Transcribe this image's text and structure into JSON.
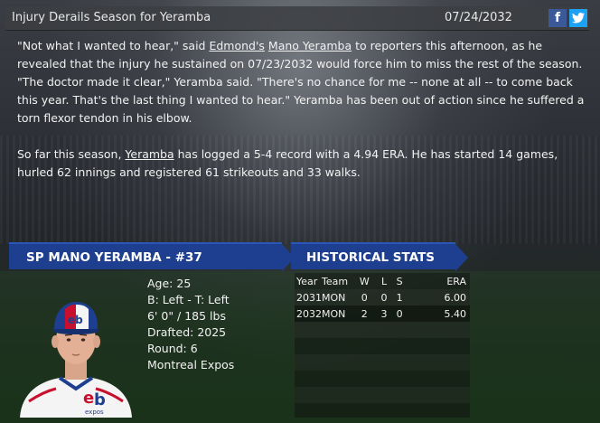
{
  "header": {
    "title": "Injury Derails Season for Yeramba",
    "date": "07/24/2032",
    "facebook_glyph": "f",
    "twitter_glyph": "t"
  },
  "article": {
    "p1_a": "\"Not what I wanted to hear,\" said ",
    "p1_team": "Edmond's",
    "p1_b": " ",
    "p1_player": "Mano Yeramba",
    "p1_c": " to reporters this afternoon, as he revealed that the injury he sustained on 07/23/2032 would force him to miss the rest of the season. \"The doctor made it clear,\" Yeramba said. \"There's no chance for me -- none at all -- to come back this year. That's the last thing I wanted to hear.\" Yeramba has been out of action since he suffered a torn flexor tendon in his elbow.",
    "p2_a": "So far this season, ",
    "p2_player": "Yeramba",
    "p2_b": " has logged a 5-4 record with a 4.94 ERA. He has started 14 games, hurled 62 innings and registered 61 strikeouts and 33 walks."
  },
  "player": {
    "banner": "SP MANO YERAMBA - #37",
    "age": "Age: 25",
    "bats_throws": "B: Left - T: Left",
    "height_weight": "6' 0\" / 185 lbs",
    "drafted": "Drafted: 2025",
    "round": "Round: 6",
    "team": "Montreal Expos"
  },
  "stats": {
    "banner": "HISTORICAL STATS",
    "headers": [
      "Year",
      "Team",
      "W",
      "L",
      "S",
      "ERA"
    ],
    "rows": [
      [
        "2031",
        "MON",
        "0",
        "0",
        "1",
        "6.00"
      ],
      [
        "2032",
        "MON",
        "2",
        "3",
        "0",
        "5.40"
      ]
    ]
  },
  "colors": {
    "banner_blue": "#1e3f8f",
    "facebook": "#3b5998",
    "twitter": "#1da1f2"
  }
}
